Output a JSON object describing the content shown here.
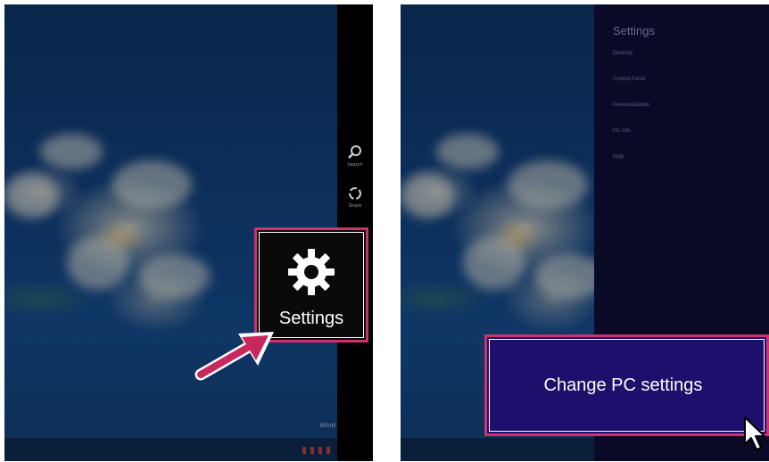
{
  "left_panel": {
    "charms": [
      {
        "name": "search",
        "label": "Search",
        "icon": "search-icon"
      },
      {
        "name": "share",
        "label": "Share",
        "icon": "share-icon"
      }
    ],
    "settings_tile": {
      "label": "Settings",
      "icon": "gear-icon"
    },
    "watermark": "Wind",
    "pointer": "arrow-pointer-icon",
    "highlight_color": "#d1306f"
  },
  "right_panel": {
    "settings_pane": {
      "title": "Settings",
      "items": [
        "Desktop",
        "Control Panel",
        "Personalization",
        "PC info",
        "Help"
      ],
      "bottom_link": "Change PC settings"
    },
    "change_tile": {
      "label": "Change PC settings",
      "background": "#1d0f6b"
    },
    "cursor": "mouse-cursor-icon"
  }
}
